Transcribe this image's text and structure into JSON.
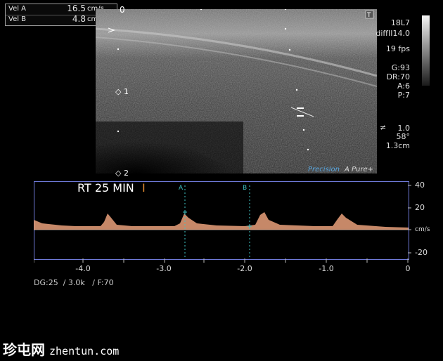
{
  "measurements": [
    {
      "label": "Vel  A",
      "value": "16.5",
      "unit": "cm/s"
    },
    {
      "label": "Vel  B",
      "value": "4.8",
      "unit": "cm/s"
    }
  ],
  "depth_markers": {
    "top": "0",
    "mid": "1",
    "bottom": "2"
  },
  "probe": {
    "name": "18L7",
    "preset": "diffII14.0",
    "frame_rate": "19 fps",
    "gain": "G:93",
    "dynamic_range": "DR:70",
    "a": "A:6",
    "p": "P:7",
    "focus": "1.0",
    "angle": "58°",
    "depth": "1.3cm"
  },
  "logos": {
    "precision": "Precision",
    "pure": "A Pure+"
  },
  "doppler": {
    "annotation": "RT 25 MIN",
    "cursor_a": "A",
    "cursor_b": "B",
    "y_ticks": [
      "40",
      "20",
      "cm/s",
      "-20"
    ],
    "x_ticks": [
      "-4.0",
      "-3.0",
      "-2.0",
      "-1.0",
      "0"
    ],
    "settings": "DG:25  / 3.0k   / F:70"
  },
  "watermark": {
    "text": "珍屯网",
    "domain": "zhentun.com"
  },
  "colors": {
    "doppler_border": "#6f7ad8",
    "spectrum": "#e9a07a",
    "cursor": "#3fc6c6"
  }
}
